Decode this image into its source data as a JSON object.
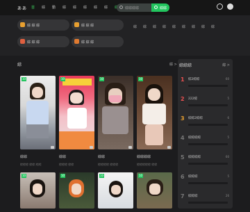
{
  "header": {
    "logo": "ああ",
    "nav": [
      "首",
      "綜",
      "動",
      "綜",
      "綜",
      "綜",
      "綜",
      "綜",
      "綜"
    ],
    "search_placeholder": "綜綜綜綜",
    "search_button": "綜綜"
  },
  "quick": {
    "pills": [
      {
        "label": "綜 綜 綜",
        "icon_color": "#e8a030"
      },
      {
        "label": "綜 綜 綜",
        "icon_color": "#e8a030"
      },
      {
        "label": "綜 綜 綜",
        "icon_color": "#e06040"
      },
      {
        "label": "綜 綜 綜",
        "icon_color": "#e07a30"
      }
    ],
    "links": [
      "綜",
      "綜",
      "綜",
      "綜",
      "綜",
      "綜",
      "綜",
      "綜",
      "綜",
      "綜"
    ]
  },
  "section": {
    "title": "綜",
    "more": "綜 >"
  },
  "cards": [
    {
      "badge": "10",
      "title": "綜綜",
      "meta": "綜綜綜 綜綜 綜綜"
    },
    {
      "badge": "10",
      "title": "綜綜",
      "meta": "綜綜綜 綜綜"
    },
    {
      "badge": "10",
      "title": "綜綜",
      "meta": "綜綜綜綜 綜綜綜"
    },
    {
      "badge": "10",
      "title": "綜綜綜綜",
      "meta": "綜綜綜綜綜 綜綜"
    },
    {
      "badge": "10",
      "title": "",
      "meta": ""
    },
    {
      "badge": "10",
      "title": "",
      "meta": ""
    },
    {
      "badge": "10",
      "title": "",
      "meta": ""
    },
    {
      "badge": "10",
      "title": "",
      "meta": ""
    }
  ],
  "ranking": {
    "title": "綜綜綜",
    "more": "綜 >",
    "items": [
      {
        "num": "1",
        "name": "綜2綜綜",
        "count": "60",
        "color": "#e85050"
      },
      {
        "num": "2",
        "name": "222綜",
        "count": "5",
        "color": "#e85050"
      },
      {
        "num": "3",
        "name": "綜綜2綜綜",
        "count": "6",
        "color": "#e8a030"
      },
      {
        "num": "4",
        "name": "綜綜綜綜",
        "count": "5",
        "color": "#777777"
      },
      {
        "num": "5",
        "name": "綜綜綜綜",
        "count": "60",
        "color": "#777777"
      },
      {
        "num": "6",
        "name": "綜綜綜",
        "count": "5",
        "color": "#777777"
      },
      {
        "num": "7",
        "name": "綜綜綜",
        "count": "26",
        "color": "#777777"
      }
    ]
  }
}
